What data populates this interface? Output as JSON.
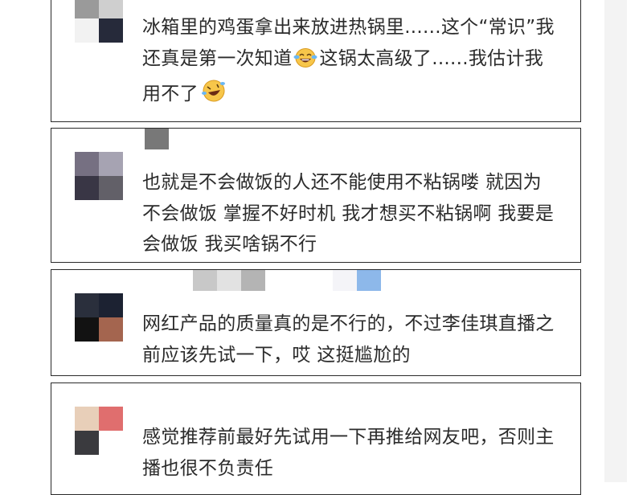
{
  "comments": [
    {
      "text_1": "冰箱里的鸡蛋拿出来放进热锅里......这个“常识”我还真是第一次知道",
      "emoji_1": "laugh-tears-emoji",
      "text_2": "这锅太高级了......我估计我用不了",
      "emoji_2": "rolling-laugh-emoji",
      "avatar_colors": [
        "#9a9a9a",
        "#cfcfcf",
        "#f2f2f2",
        "#262a3a"
      ]
    },
    {
      "text": "也就是不会做饭的人还不能使用不粘锅喽 就因为不会做饭 掌握不好时机 我才想买不粘锅啊 我要是会做饭 我买啥锅不行",
      "avatar_colors": [
        "#767082",
        "#a6a3b2",
        "#393645",
        "#626068"
      ],
      "blur_colors": [
        "#787878"
      ]
    },
    {
      "text": "网红产品的质量真的是不行的，不过李佳琪直播之前应该先试一下，哎 这挺尴尬的",
      "avatar_colors": [
        "#2a2f3c",
        "#1c2232",
        "#121212",
        "#a4654f"
      ],
      "blur_colors": [
        "#c8c8c8",
        "#e2e2e2",
        "#b4b4b4"
      ],
      "blur_colors_2": [
        "#f4f4f8",
        "#8db8ea"
      ]
    },
    {
      "text": "感觉推荐前最好先试用一下再推给网友吧，否则主播也很不负责任",
      "avatar_colors": [
        "#e8cfb9",
        "#e06e6e",
        "#3a3a3e",
        "#ffffff"
      ]
    }
  ]
}
